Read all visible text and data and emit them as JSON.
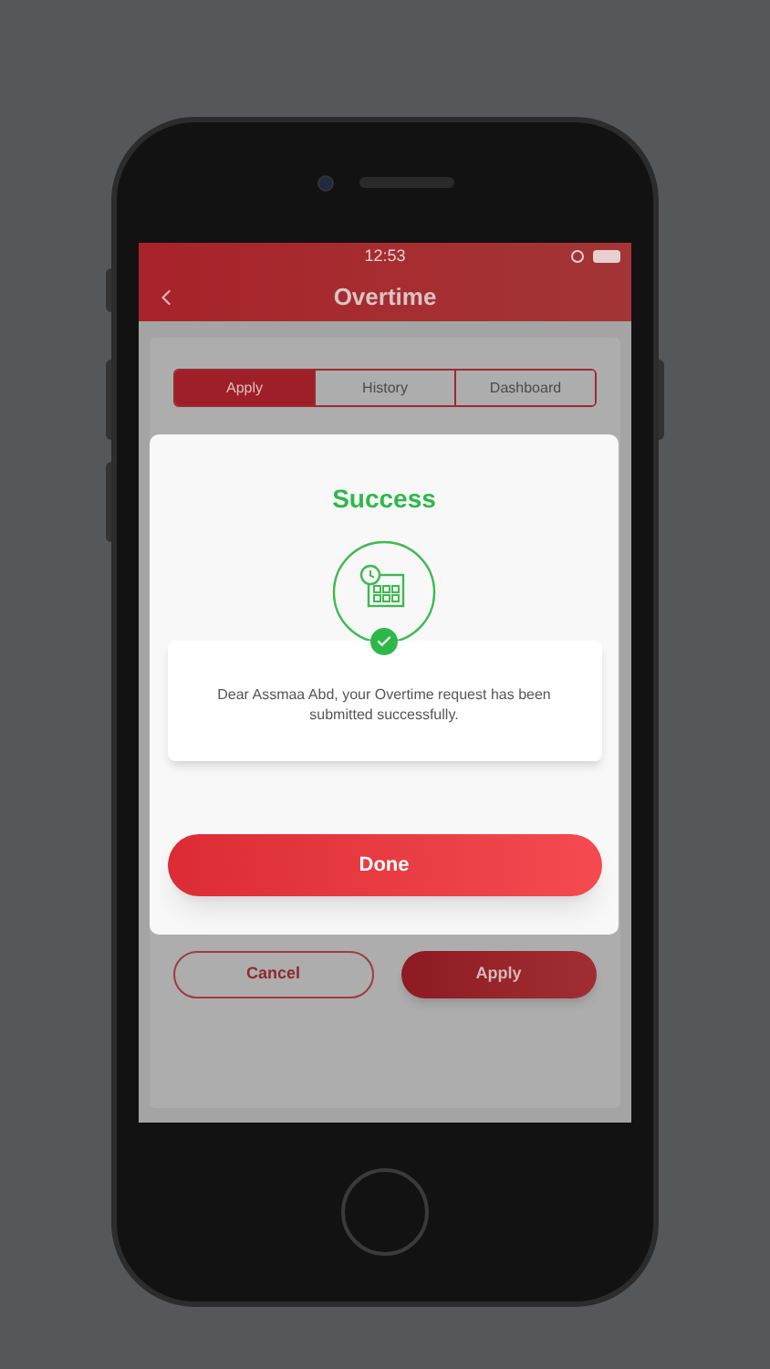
{
  "status_bar": {
    "time": "12:53"
  },
  "header": {
    "title": "Overtime"
  },
  "tabs": [
    {
      "label": "Apply",
      "selected": true
    },
    {
      "label": "History",
      "selected": false
    },
    {
      "label": "Dashboard",
      "selected": false
    }
  ],
  "actions": [
    {
      "label": "Cancel",
      "kind": "outline"
    },
    {
      "label": "Apply",
      "kind": "filled"
    }
  ],
  "dialog": {
    "title": "Success",
    "message": "Dear Assmaa Abd, your Overtime request has been submitted successfully.",
    "button": "Done"
  }
}
